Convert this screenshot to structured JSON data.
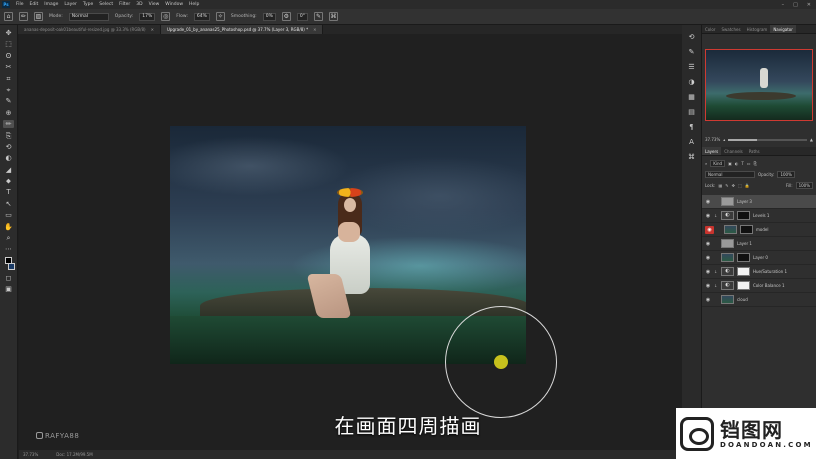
{
  "menubar": {
    "app_icon": "Ps",
    "items": [
      "File",
      "Edit",
      "Image",
      "Layer",
      "Type",
      "Select",
      "Filter",
      "3D",
      "View",
      "Window",
      "Help"
    ],
    "window_controls": [
      "–",
      "□",
      "✕"
    ]
  },
  "options": {
    "mode_label": "Mode:",
    "mode_value": "Normal",
    "opacity_label": "Opacity:",
    "opacity_value": "17%",
    "flow_label": "Flow:",
    "flow_value": "64%",
    "smoothing_label": "Smoothing:",
    "smoothing_value": "0%",
    "angle_value": "0°"
  },
  "tabs": [
    {
      "label": "ananas-deposit-oak01beautiful-resized.jpg @ 33.3% (RGB/8)",
      "active": false
    },
    {
      "label": "Upgrade_01_by_ananas25_Photoshop.psd @ 37.7% (Layer 3, RGB/8) *",
      "active": true
    }
  ],
  "tools": [
    "✥",
    "⬚",
    "ʘ",
    "✂",
    "⌗",
    "⌖",
    "✎",
    "⊕",
    "✏",
    "⎘",
    "⟲",
    "◐",
    "◢",
    "⬥",
    "T",
    "↖",
    "▭",
    "✋",
    "⌕",
    "⋯"
  ],
  "subtitle": "在画面四周描画",
  "watermark": "RAFYA88",
  "status": {
    "zoom": "37.73%",
    "doc": "Doc: 17.2M/99.5M"
  },
  "dock_icons": [
    "history-icon",
    "brush-icon",
    "properties-icon",
    "adjust-icon",
    "styles-icon",
    "libraries-icon",
    "paragraph-icon",
    "character-icon",
    "glyph-icon"
  ],
  "panel_tabs": [
    "Color",
    "Swatches",
    "Histogram",
    "Navigator"
  ],
  "navigator_zoom": "37.73%",
  "zoom_slider_level": 0.36,
  "layers_tabs": [
    "Layers",
    "Channels",
    "Paths"
  ],
  "layers": {
    "kind_label": "Kind",
    "blend_mode": "Normal",
    "opacity_label": "Opacity:",
    "opacity_value": "100%",
    "lock_label": "Lock:",
    "fill_label": "Fill:",
    "fill_value": "100%",
    "rows": [
      {
        "name": "Layer 3",
        "thumb": "gray",
        "selected": true,
        "clip": false,
        "eye_red": false,
        "mask": ""
      },
      {
        "name": "Levels 1",
        "thumb": "adj",
        "selected": false,
        "clip": true,
        "eye_red": false,
        "mask": "black"
      },
      {
        "name": "model",
        "thumb": "scene",
        "selected": false,
        "clip": false,
        "eye_red": true,
        "mask": "black"
      },
      {
        "name": "Layer 1",
        "thumb": "gray",
        "selected": false,
        "clip": false,
        "eye_red": false,
        "mask": ""
      },
      {
        "name": "Layer 0",
        "thumb": "scene",
        "selected": false,
        "clip": false,
        "eye_red": false,
        "mask": "black"
      },
      {
        "name": "Hue/Saturation 1",
        "thumb": "adj",
        "selected": false,
        "clip": true,
        "eye_red": false,
        "mask": "white"
      },
      {
        "name": "Color Balance 1",
        "thumb": "adj",
        "selected": false,
        "clip": true,
        "eye_red": false,
        "mask": "white"
      },
      {
        "name": "cloud",
        "thumb": "scene",
        "selected": false,
        "clip": false,
        "eye_red": false,
        "mask": ""
      }
    ]
  },
  "logo": {
    "cn": "铛图网",
    "en": "DOANDOAN.COM"
  }
}
